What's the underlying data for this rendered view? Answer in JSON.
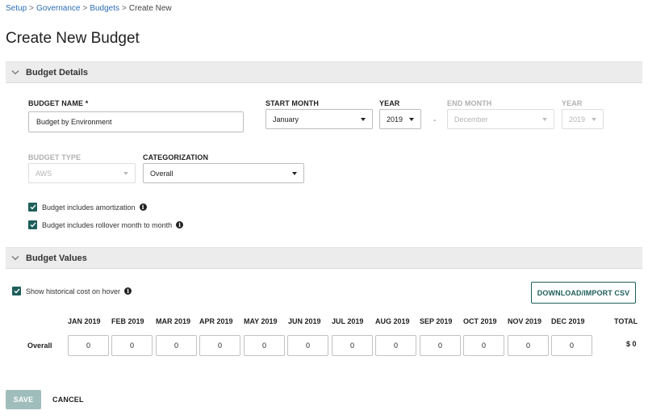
{
  "breadcrumb": {
    "items": [
      "Setup",
      "Governance",
      "Budgets"
    ],
    "current": "Create New",
    "separator": ">"
  },
  "page_title": "Create New Budget",
  "budget_details": {
    "section_title": "Budget Details",
    "budget_name": {
      "label": "BUDGET NAME *",
      "value": "Budget by Environment"
    },
    "start_month": {
      "label": "START MONTH",
      "value": "January"
    },
    "start_year": {
      "label": "YEAR",
      "value": "2019"
    },
    "range_separator": "-",
    "end_month": {
      "label": "END MONTH",
      "value": "December",
      "disabled": true
    },
    "end_year": {
      "label": "YEAR",
      "value": "2019",
      "disabled": true
    },
    "budget_type": {
      "label": "BUDGET TYPE",
      "value": "AWS",
      "disabled": true
    },
    "categorization": {
      "label": "CATEGORIZATION",
      "value": "Overall"
    },
    "checkboxes": [
      {
        "label": "Budget includes amortization",
        "checked": true
      },
      {
        "label": "Budget includes rollover month to month",
        "checked": true
      }
    ]
  },
  "budget_values": {
    "section_title": "Budget Values",
    "show_historical": {
      "label": "Show historical cost on hover",
      "checked": true
    },
    "download_button": "DOWNLOAD/IMPORT CSV",
    "months": [
      "JAN 2019",
      "FEB 2019",
      "MAR 2019",
      "APR 2019",
      "MAY 2019",
      "JUN 2019",
      "JUL 2019",
      "AUG 2019",
      "SEP 2019",
      "OCT 2019",
      "NOV 2019",
      "DEC 2019"
    ],
    "total_header": "TOTAL",
    "rows": [
      {
        "label": "Overall",
        "values": [
          "0",
          "0",
          "0",
          "0",
          "0",
          "0",
          "0",
          "0",
          "0",
          "0",
          "0",
          "0"
        ],
        "total": "$ 0"
      }
    ]
  },
  "footer": {
    "save_label": "SAVE",
    "cancel_label": "CANCEL"
  },
  "colors": {
    "accent": "#1e5e5a",
    "link": "#2f6db5",
    "save_disabled": "#9fbdbb",
    "section_bg": "#ececec"
  }
}
